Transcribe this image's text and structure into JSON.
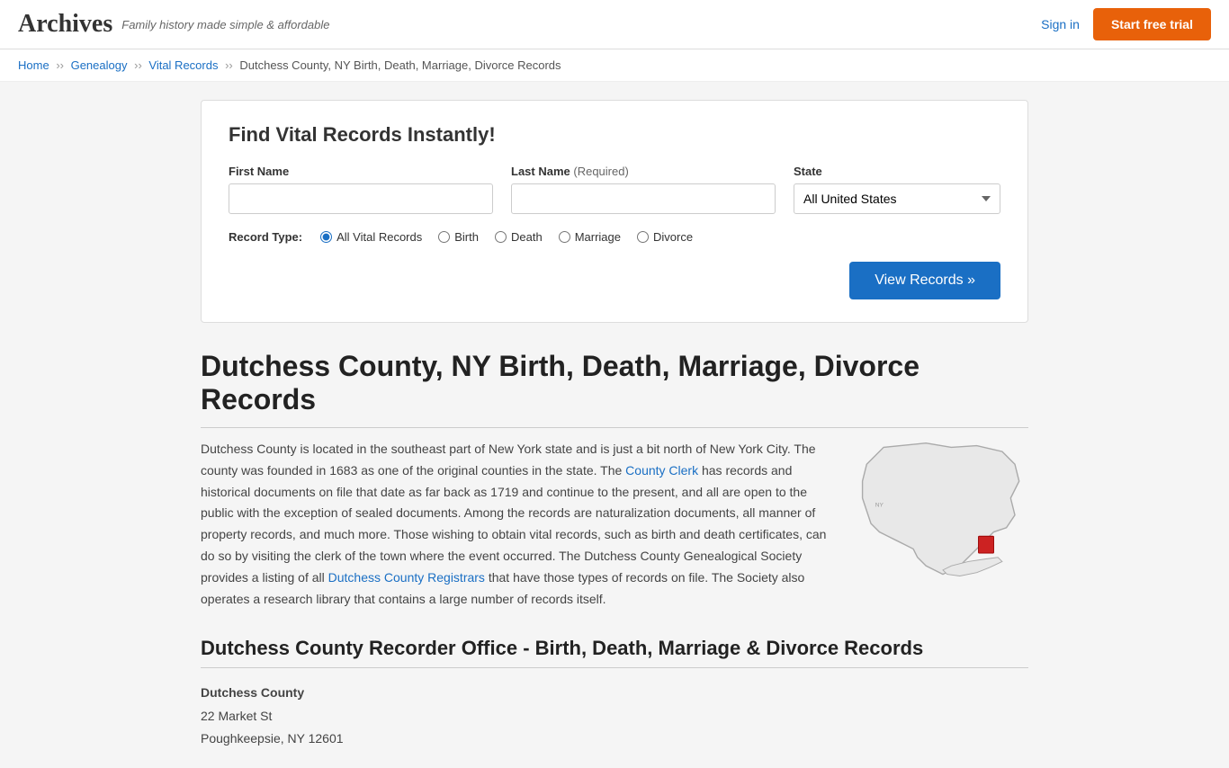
{
  "header": {
    "logo": "Archives",
    "tagline": "Family history made simple & affordable",
    "sign_in": "Sign in",
    "start_trial": "Start free trial"
  },
  "breadcrumb": {
    "home": "Home",
    "genealogy": "Genealogy",
    "vital_records": "Vital Records",
    "current": "Dutchess County, NY Birth, Death, Marriage, Divorce Records"
  },
  "search": {
    "title": "Find Vital Records Instantly!",
    "first_name_label": "First Name",
    "last_name_label": "Last Name",
    "last_name_required": "(Required)",
    "state_label": "State",
    "state_value": "All United States",
    "record_type_label": "Record Type:",
    "record_types": [
      "All Vital Records",
      "Birth",
      "Death",
      "Marriage",
      "Divorce"
    ],
    "view_records_btn": "View Records »"
  },
  "page": {
    "title": "Dutchess County, NY Birth, Death, Marriage, Divorce Records",
    "body_text": "Dutchess County is located in the southeast part of New York state and is just a bit north of New York City. The county was founded in 1683 as one of the original counties in the state. The County Clerk has records and historical documents on file that date as far back as 1719 and continue to the present, and all are open to the public with the exception of sealed documents. Among the records are naturalization documents, all manner of property records, and much more. Those wishing to obtain vital records, such as birth and death certificates, can do so by visiting the clerk of the town where the event occurred. The Dutchess County Genealogical Society provides a listing of all Dutchess County Registrars that have those types of records on file. The Society also operates a research library that contains a large number of records itself.",
    "county_clerk_link": "County Clerk",
    "registrars_link": "Dutchess County Registrars",
    "section2_title": "Dutchess County Recorder Office - Birth, Death, Marriage & Divorce Records",
    "office_name": "Dutchess County",
    "office_address1": "22 Market St",
    "office_address2": "Poughkeepsie, NY 12601"
  }
}
